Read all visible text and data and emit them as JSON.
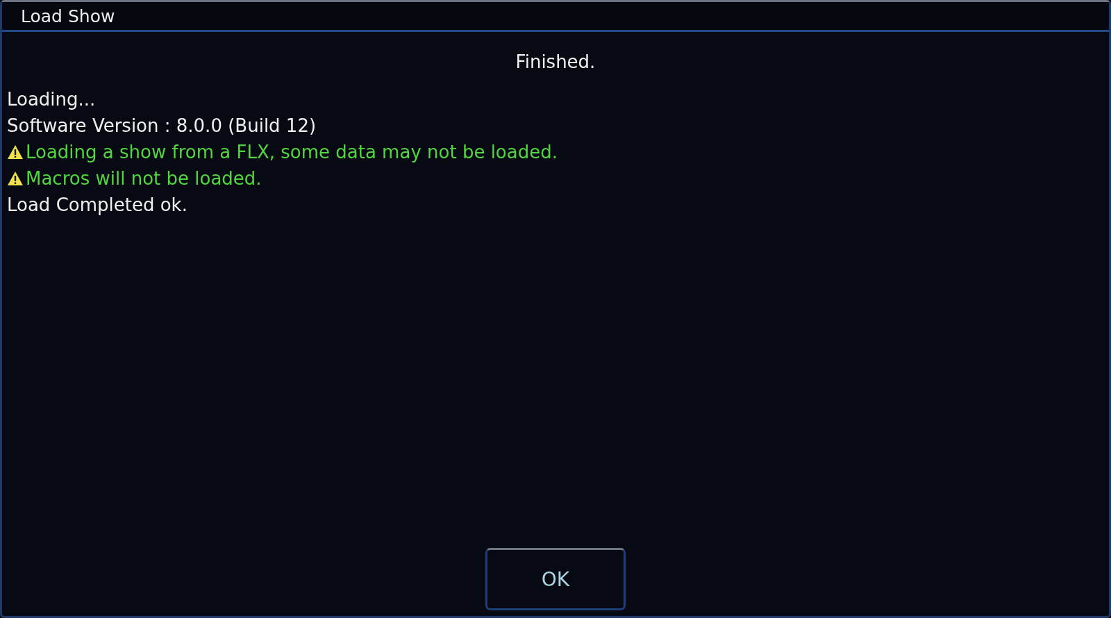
{
  "window": {
    "title": "Load Show"
  },
  "status": "Finished.",
  "log": [
    {
      "kind": "info",
      "text": "Loading..."
    },
    {
      "kind": "info",
      "text": "Software Version : 8.0.0 (Build 12)"
    },
    {
      "kind": "warning",
      "text": "Loading a show from a FLX, some data may not be loaded."
    },
    {
      "kind": "warning",
      "text": "Macros will not be loaded."
    },
    {
      "kind": "info",
      "text": "Load Completed ok."
    }
  ],
  "buttons": [
    "OK"
  ]
}
